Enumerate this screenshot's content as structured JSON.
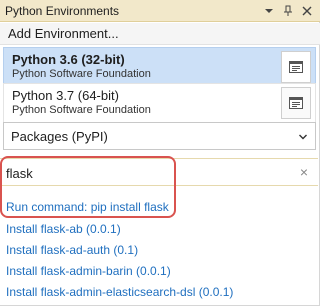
{
  "window": {
    "title": "Python Environments",
    "dropdown_icon": "chevron-down-icon",
    "pin_icon": "pin-icon",
    "close_icon": "close-icon"
  },
  "add_environment": {
    "label": "Add Environment..."
  },
  "environments": [
    {
      "name": "Python 3.6 (32-bit)",
      "publisher": "Python Software Foundation",
      "selected": true
    },
    {
      "name": "Python 3.7 (64-bit)",
      "publisher": "Python Software Foundation",
      "selected": false
    }
  ],
  "packages_dropdown": {
    "selected": "Packages (PyPI)"
  },
  "search": {
    "value": "flask",
    "clear_label": "×"
  },
  "run_command": {
    "label": "Run command: pip install flask"
  },
  "results": [
    "Install flask-ab (0.0.1)",
    "Install flask-ad-auth (0.1)",
    "Install flask-admin-barin (0.0.1)",
    "Install flask-admin-elasticsearch-dsl (0.0.1)"
  ],
  "colors": {
    "title_bar": "#f2e8ca",
    "selected_env": "#cce0f7",
    "link": "#1f6fbf",
    "highlight": "#d9534f"
  }
}
